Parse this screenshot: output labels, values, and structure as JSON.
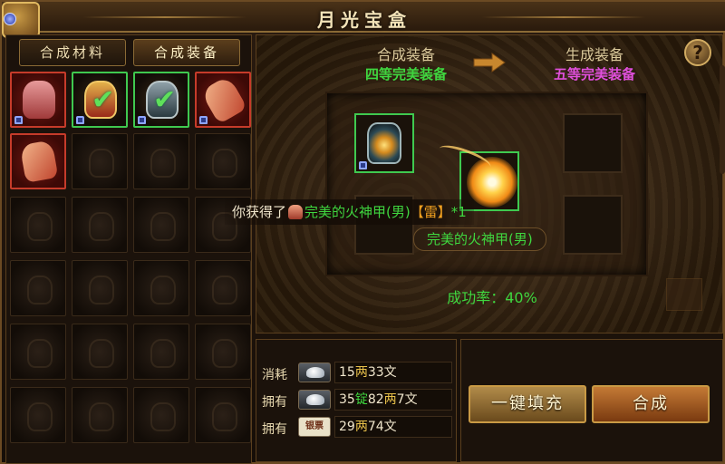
{
  "window": {
    "title": "月光宝盒"
  },
  "left_panel": {
    "tabs": [
      {
        "label": "合成材料",
        "active": false
      },
      {
        "label": "合成装备",
        "active": true
      }
    ],
    "slots": [
      {
        "item": "pink-armor",
        "border": "red",
        "locked": true,
        "checked": false
      },
      {
        "item": "gold-armor",
        "border": "green",
        "locked": true,
        "checked": true
      },
      {
        "item": "steel-armor",
        "border": "green",
        "locked": true,
        "checked": true
      },
      {
        "item": "flame-cape",
        "border": "red",
        "locked": true,
        "checked": false
      },
      {
        "item": "flame-armor",
        "border": "red",
        "locked": false,
        "checked": false
      }
    ]
  },
  "synthesis": {
    "source_header": "合成装备",
    "source_grade": "四等完美装备",
    "result_header": "生成装备",
    "result_grade": "五等完美装备",
    "help_label": "?",
    "success_rate_label": "成功率：40%",
    "notice": {
      "prefix": "你获得了",
      "item_name": "完美的火神甲(男)",
      "element": "【雷】",
      "count": "*1"
    },
    "item_tooltip": "完美的火神甲(男)"
  },
  "cost": {
    "rows": [
      {
        "label": "消耗",
        "icon": "silver-ingot-icon",
        "parts": [
          [
            "15",
            "w"
          ],
          [
            "两",
            "g"
          ],
          [
            "33文",
            "w"
          ]
        ]
      },
      {
        "label": "拥有",
        "icon": "silver-ingot-icon",
        "parts": [
          [
            "35",
            "w"
          ],
          [
            "锭",
            "gr"
          ],
          [
            "82",
            "w"
          ],
          [
            "两",
            "g"
          ],
          [
            "7文",
            "w"
          ]
        ]
      },
      {
        "label": "拥有",
        "icon": "banknote-icon",
        "icon_text": "银票",
        "parts": [
          [
            "29",
            "w"
          ],
          [
            "两",
            "g"
          ],
          [
            "74文",
            "w"
          ]
        ]
      }
    ]
  },
  "buttons": {
    "fill": "一键填充",
    "synthesize": "合成"
  },
  "colors": {
    "success_green": "#3fd63f",
    "perfect5_magenta": "#e04fdc",
    "gold_text": "#e8c04a"
  }
}
